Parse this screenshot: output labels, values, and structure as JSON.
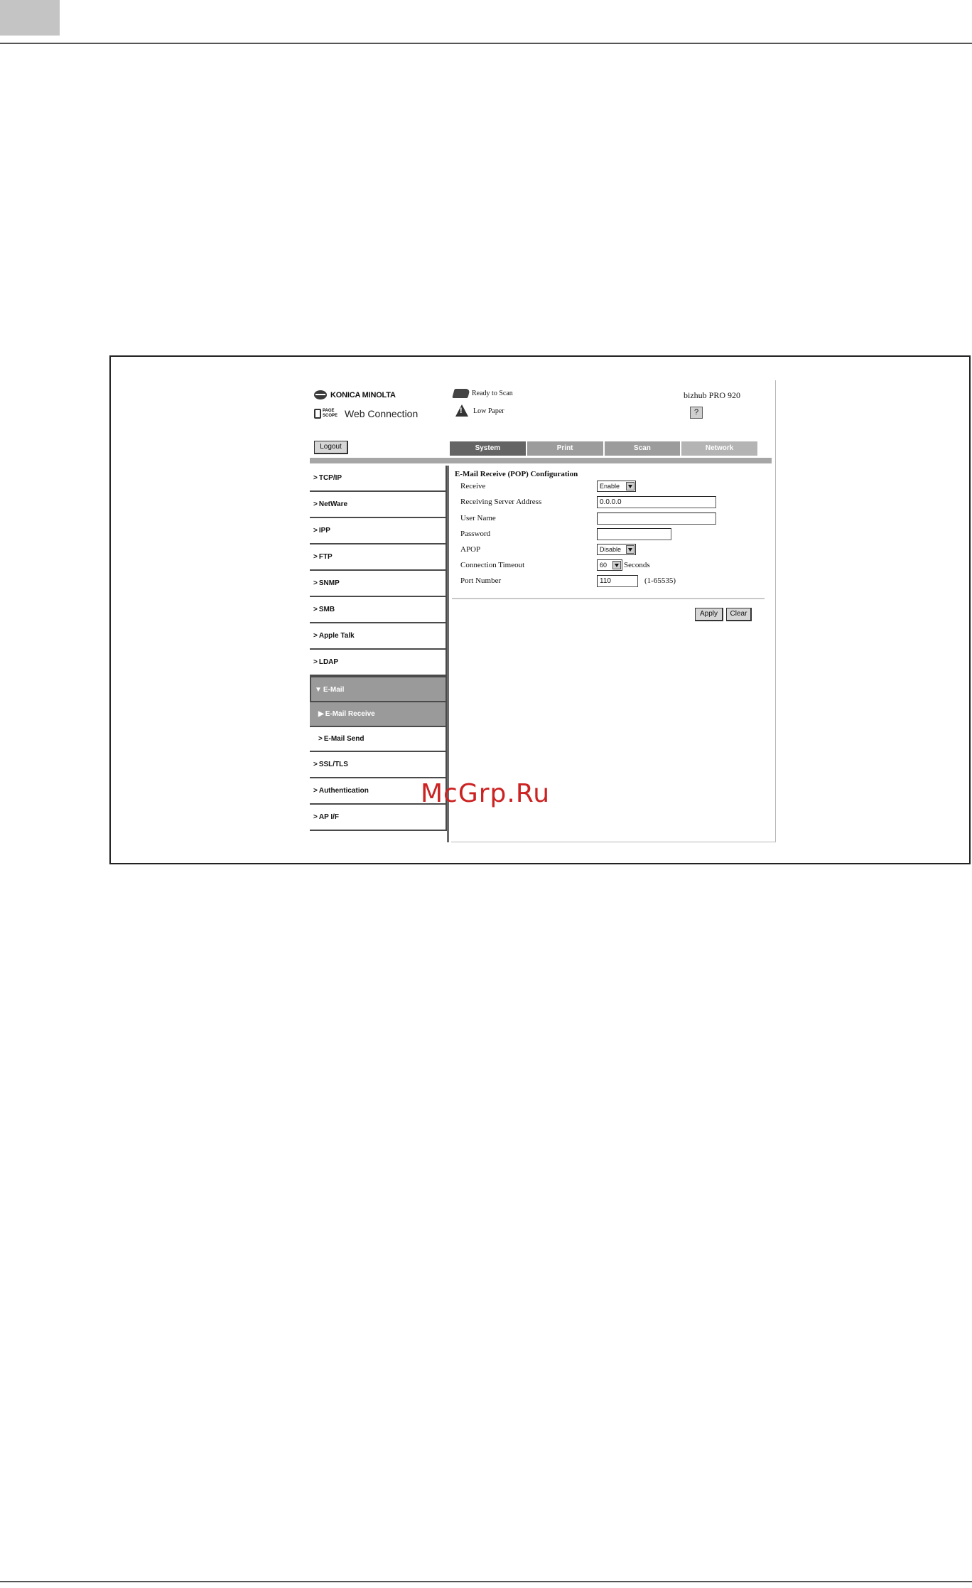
{
  "header": {
    "brand": "KONICA MINOLTA",
    "logo_text": "PAGE SCOPE",
    "product": "Web Connection",
    "status_ready": "Ready to Scan",
    "status_paper": "Low Paper",
    "device": "bizhub PRO 920",
    "help_glyph": "?",
    "logout_label": "Logout"
  },
  "tabs": [
    "System",
    "Print",
    "Scan",
    "Network"
  ],
  "active_tab": "System",
  "sidebar": {
    "items": [
      {
        "label": "TCP/IP",
        "arrow": ">"
      },
      {
        "label": "NetWare",
        "arrow": ">"
      },
      {
        "label": "IPP",
        "arrow": ">"
      },
      {
        "label": "FTP",
        "arrow": ">"
      },
      {
        "label": "SNMP",
        "arrow": ">"
      },
      {
        "label": "SMB",
        "arrow": ">"
      },
      {
        "label": "Apple Talk",
        "arrow": ">"
      },
      {
        "label": "LDAP",
        "arrow": ">"
      },
      {
        "label": "E-Mail",
        "arrow": "▼"
      },
      {
        "label": "E-Mail Receive",
        "arrow": "▶"
      },
      {
        "label": "E-Mail Send",
        "arrow": ">"
      },
      {
        "label": "SSL/TLS",
        "arrow": ">"
      },
      {
        "label": "Authentication",
        "arrow": ">"
      },
      {
        "label": "AP I/F",
        "arrow": ">"
      }
    ]
  },
  "form": {
    "title": "E-Mail Receive (POP) Configuration",
    "receive_label": "Receive",
    "receive_value": "Enable",
    "server_label": "Receiving Server Address",
    "server_value": "0.0.0.0",
    "user_label": "User Name",
    "user_value": "",
    "password_label": "Password",
    "password_value": "",
    "apop_label": "APOP",
    "apop_value": "Disable",
    "timeout_label": "Connection Timeout",
    "timeout_value": "60",
    "timeout_unit": "Seconds",
    "port_label": "Port Number",
    "port_value": "110",
    "port_range": "(1-65535)",
    "apply_label": "Apply",
    "clear_label": "Clear"
  },
  "watermark": "McGrp.Ru",
  "colors": {
    "tab_active": "#646464",
    "tab_inactive": "#9c9c9c",
    "sidebar_expanded": "#9a9a9a",
    "watermark": "#cc2222"
  }
}
